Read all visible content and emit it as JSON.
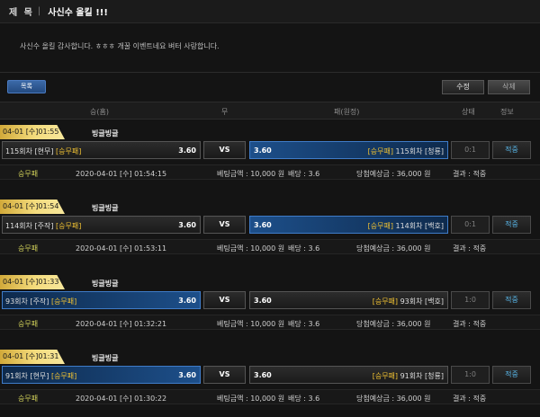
{
  "header": {
    "label": "제 목",
    "separator": "|",
    "subject": "사신수 올킬 !!!"
  },
  "content": {
    "text": "사신수 올킬 감사합니다. ㅎㅎㅎ 개꿀 이벤트네요 벼터 사랑합니다."
  },
  "buttons": {
    "list": "목록",
    "edit": "수정",
    "delete": "삭제"
  },
  "columns": {
    "home": "승(홈)",
    "draw": "무",
    "away": "패(원정)",
    "status": "상태",
    "info": "정보"
  },
  "cards": [
    {
      "tag": "04-01 [수]01:55",
      "title": "빙글빙글",
      "home_name": "115회차 [현무]",
      "home_pick": "[승무패]",
      "home_odd": "3.60",
      "home_selected": false,
      "vs": "VS",
      "away_odd": "3.60",
      "away_pick": "[승무패]",
      "away_name": "115회차 [청룡]",
      "away_selected": true,
      "score": "0:1",
      "hit": "적중",
      "info": {
        "type": "승무패",
        "date": "2020-04-01 [수] 01:54:15",
        "bet": "베팅금액 : 10,000 원",
        "rate": "배당 : 3.6",
        "win": "당첨예상금 : 36,000 원",
        "result": "결과 : 적중"
      }
    },
    {
      "tag": "04-01 [수]01:54",
      "title": "빙글빙글",
      "home_name": "114회차 [주작]",
      "home_pick": "[승무패]",
      "home_odd": "3.60",
      "home_selected": false,
      "vs": "VS",
      "away_odd": "3.60",
      "away_pick": "[승무패]",
      "away_name": "114회차 [백호]",
      "away_selected": true,
      "score": "0:1",
      "hit": "적중",
      "info": {
        "type": "승무패",
        "date": "2020-04-01 [수] 01:53:11",
        "bet": "베팅금액 : 10,000 원",
        "rate": "배당 : 3.6",
        "win": "당첨예상금 : 36,000 원",
        "result": "결과 : 적중"
      }
    },
    {
      "tag": "04-01 [수]01:33",
      "title": "빙글빙글",
      "home_name": "93회차 [주작]",
      "home_pick": "[승무패]",
      "home_odd": "3.60",
      "home_selected": true,
      "vs": "VS",
      "away_odd": "3.60",
      "away_pick": "[승무패]",
      "away_name": "93회차 [백호]",
      "away_selected": false,
      "score": "1:0",
      "hit": "적중",
      "info": {
        "type": "승무패",
        "date": "2020-04-01 [수] 01:32:21",
        "bet": "베팅금액 : 10,000 원",
        "rate": "배당 : 3.6",
        "win": "당첨예상금 : 36,000 원",
        "result": "결과 : 적중"
      }
    },
    {
      "tag": "04-01 [수]01:31",
      "title": "빙글빙글",
      "home_name": "91회차 [현무]",
      "home_pick": "[승무패]",
      "home_odd": "3.60",
      "home_selected": true,
      "vs": "VS",
      "away_odd": "3.60",
      "away_pick": "[승무패]",
      "away_name": "91회차 [청룡]",
      "away_selected": false,
      "score": "1:0",
      "hit": "적중",
      "info": {
        "type": "승무패",
        "date": "2020-04-01 [수] 01:30:22",
        "bet": "베팅금액 : 10,000 원",
        "rate": "배당 : 3.6",
        "win": "당첨예상금 : 36,000 원",
        "result": "결과 : 적중"
      }
    }
  ]
}
